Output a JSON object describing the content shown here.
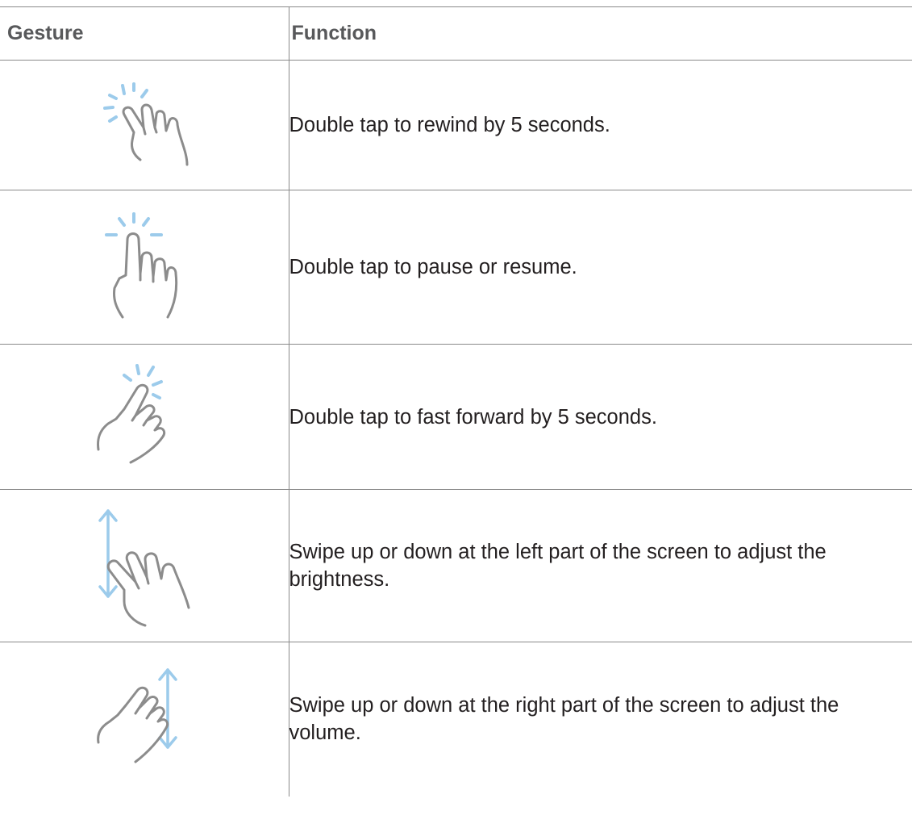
{
  "table": {
    "header": {
      "gesture": "Gesture",
      "function": "Function"
    },
    "rows": [
      {
        "icon": "double-tap-left-hand-icon",
        "function": "Double tap to rewind by 5 seconds."
      },
      {
        "icon": "double-tap-center-hand-icon",
        "function": "Double tap to pause or resume."
      },
      {
        "icon": "double-tap-right-hand-icon",
        "function": "Double tap to fast forward by 5 seconds."
      },
      {
        "icon": "swipe-left-side-hand-icon",
        "function": "Swipe up or down at the left part of the screen to adjust the brightness."
      },
      {
        "icon": "swipe-right-side-hand-icon",
        "function": "Swipe up or down at the right part of the screen to adjust the volume."
      }
    ]
  },
  "colors": {
    "text": "#231f20",
    "header_text": "#58595b",
    "rule": "#8a8a8a",
    "icon_stroke": "#8c8c8c",
    "icon_accent": "#9ccbeb"
  }
}
